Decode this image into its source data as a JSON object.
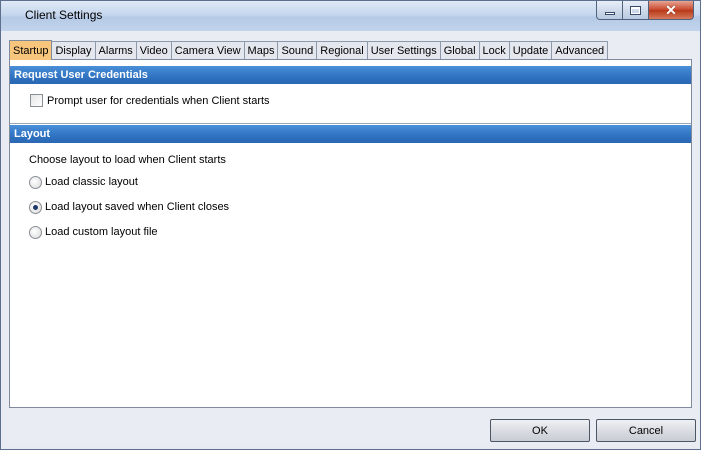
{
  "window": {
    "title": "Client Settings"
  },
  "tabs": [
    {
      "label": "Startup",
      "active": true
    },
    {
      "label": "Display"
    },
    {
      "label": "Alarms"
    },
    {
      "label": "Video"
    },
    {
      "label": "Camera View"
    },
    {
      "label": "Maps"
    },
    {
      "label": "Sound"
    },
    {
      "label": "Regional"
    },
    {
      "label": "User Settings"
    },
    {
      "label": "Global"
    },
    {
      "label": "Lock"
    },
    {
      "label": "Update"
    },
    {
      "label": "Advanced"
    }
  ],
  "credentials": {
    "header": "Request User Credentials",
    "prompt_label": "Prompt user for credentials when  Client starts",
    "prompt_checked": false
  },
  "layout": {
    "header": "Layout",
    "question": "Choose layout to load when Client starts",
    "options": [
      {
        "label": "Load classic layout",
        "selected": false
      },
      {
        "label": "Load layout saved when Client closes",
        "selected": true
      },
      {
        "label": "Load custom layout file",
        "selected": false
      }
    ]
  },
  "buttons": {
    "ok": "OK",
    "cancel": "Cancel"
  },
  "colors": {
    "active_tab": "#f8c57c",
    "section_header": "#2f73c2",
    "close_button": "#c7452a"
  }
}
